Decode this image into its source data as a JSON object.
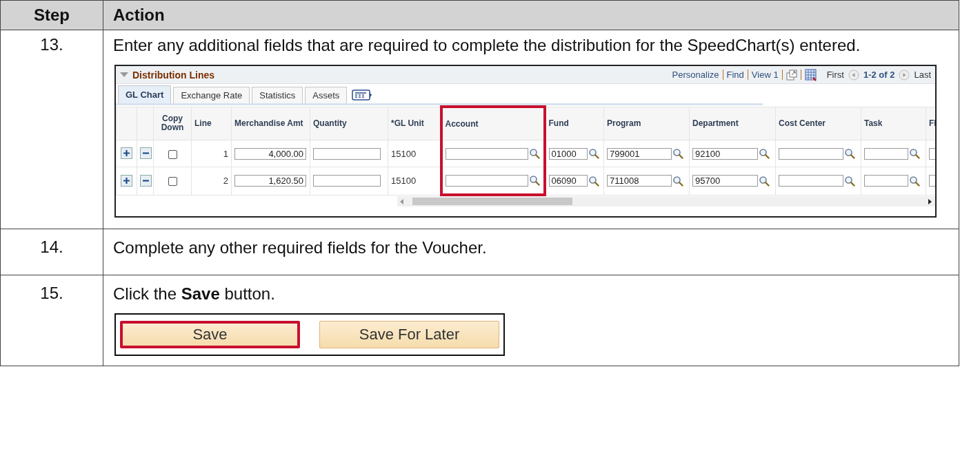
{
  "header": {
    "step": "Step",
    "action": "Action"
  },
  "steps": [
    {
      "number": "13.",
      "instruction": "Enter any additional fields that are required to complete the distribution for the SpeedChart(s) entered.",
      "figure": {
        "kind": "grid",
        "title": "Distribution Lines",
        "nav_links": [
          "Personalize",
          "Find",
          "View 1"
        ],
        "first": "First",
        "range": "1-2 of 2",
        "last": "Last",
        "tabs": [
          {
            "label": "GL Chart",
            "selected": true
          },
          {
            "label": "Exchange Rate",
            "selected": false
          },
          {
            "label": "Statistics",
            "selected": false
          },
          {
            "label": "Assets",
            "selected": false
          }
        ],
        "columns": [
          {
            "kind": "add"
          },
          {
            "kind": "delete"
          },
          {
            "label": "Copy Down",
            "kind": "checkbox",
            "highlighted": false
          },
          {
            "label": "Line",
            "kind": "number",
            "highlighted": false
          },
          {
            "label": "Merchandise Amt",
            "kind": "amount",
            "highlighted": false
          },
          {
            "label": "Quantity",
            "kind": "input",
            "highlighted": false
          },
          {
            "label": "*GL Unit",
            "kind": "text",
            "highlighted": false
          },
          {
            "label": "Account",
            "kind": "lookup",
            "highlighted": true
          },
          {
            "label": "Fund",
            "kind": "lookup",
            "highlighted": false
          },
          {
            "label": "Program",
            "kind": "lookup",
            "highlighted": false
          },
          {
            "label": "Department",
            "kind": "lookup",
            "highlighted": false
          },
          {
            "label": "Cost Center",
            "kind": "lookup",
            "highlighted": false
          },
          {
            "label": "Task",
            "kind": "lookup",
            "highlighted": false
          },
          {
            "label": "Fl",
            "kind": "input",
            "highlighted": false
          }
        ],
        "rows": [
          {
            "cells": [
              {},
              {},
              {
                "checked": false
              },
              {
                "value": "1"
              },
              {
                "value": "4,000.00"
              },
              {},
              {
                "value": "15100"
              },
              {},
              {
                "value": "01000"
              },
              {
                "value": "799001"
              },
              {
                "value": "92100"
              },
              {},
              {},
              {}
            ]
          },
          {
            "cells": [
              {},
              {},
              {
                "checked": false
              },
              {
                "value": "2"
              },
              {
                "value": "1,620.50"
              },
              {},
              {
                "value": "15100"
              },
              {},
              {
                "value": "06090"
              },
              {
                "value": "711008"
              },
              {
                "value": "95700"
              },
              {},
              {},
              {}
            ]
          }
        ]
      }
    },
    {
      "number": "14.",
      "instruction": "Complete any other required fields for the Voucher."
    },
    {
      "number": "15.",
      "instruction": "Click the **Save** button.",
      "figure": {
        "kind": "buttons",
        "buttons": [
          {
            "label": "Save",
            "highlighted": true
          },
          {
            "label": "Save For Later",
            "highlighted": false
          }
        ]
      }
    }
  ]
}
